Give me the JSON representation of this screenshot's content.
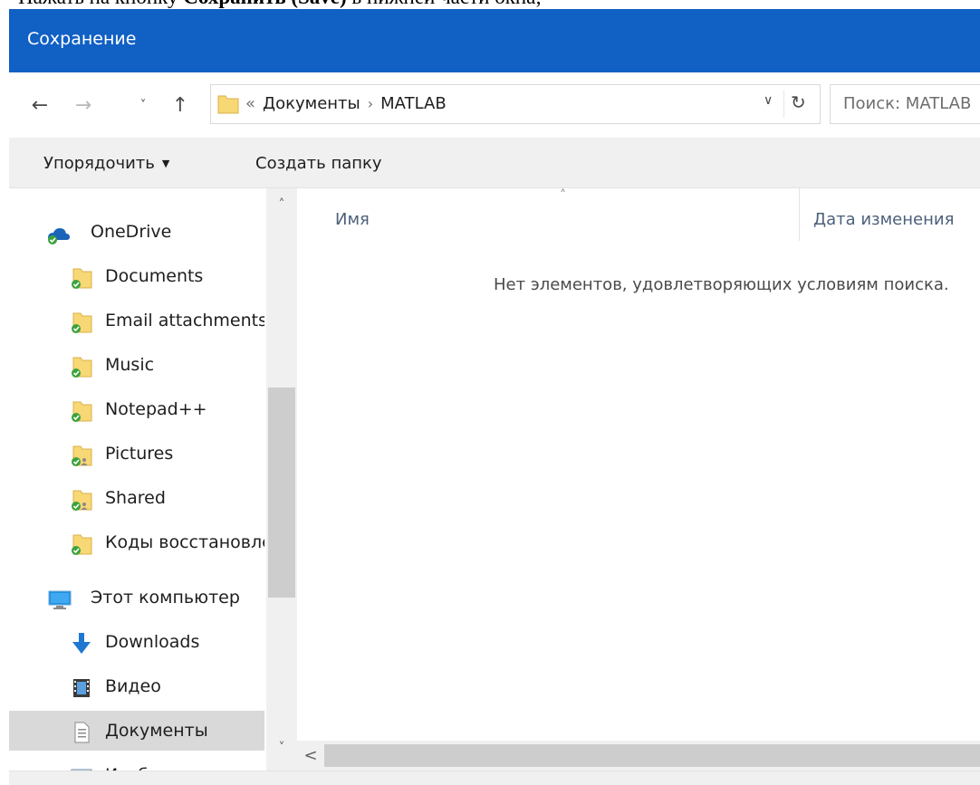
{
  "doc_caption": {
    "prefix": "Нажать на кнопку ",
    "bold": "Сохранить (Save)",
    "suffix": " в нижней части окна;"
  },
  "window": {
    "title": "Сохранение"
  },
  "nav": {
    "back_icon": "←",
    "forward_icon": "→",
    "recent_icon": "˅",
    "up_icon": "↑",
    "breadcrumb_overflow": "«",
    "breadcrumb": [
      "Документы",
      "MATLAB"
    ],
    "breadcrumb_sep": "›",
    "dropdown_icon": "∨",
    "refresh_icon": "↻",
    "search_placeholder": "Поиск: MATLAB"
  },
  "toolbar": {
    "organize_label": "Упорядочить",
    "organize_caret": "▼",
    "new_folder_label": "Создать папку"
  },
  "sidebar": {
    "items": [
      {
        "label": "OneDrive",
        "icon": "onedrive-cloud-icon"
      },
      {
        "label": "Documents",
        "icon": "synced-folder-icon"
      },
      {
        "label": "Email attachments",
        "icon": "synced-folder-icon"
      },
      {
        "label": "Music",
        "icon": "synced-folder-icon"
      },
      {
        "label": "Notepad++",
        "icon": "synced-folder-icon"
      },
      {
        "label": "Pictures",
        "icon": "shared-synced-folder-icon"
      },
      {
        "label": "Shared",
        "icon": "shared-synced-folder-icon"
      },
      {
        "label": "Коды восстановления",
        "icon": "synced-folder-icon"
      },
      {
        "label": "Этот компьютер",
        "icon": "computer-icon"
      },
      {
        "label": "Downloads",
        "icon": "download-icon"
      },
      {
        "label": "Видео",
        "icon": "video-icon"
      },
      {
        "label": "Документы",
        "icon": "documents-icon",
        "selected": true
      },
      {
        "label": "Изображения",
        "icon": "pictures-icon"
      }
    ]
  },
  "scroll": {
    "up": "˄",
    "down": "˅",
    "left": "<",
    "sort_indicator": "˄"
  },
  "content": {
    "columns": [
      "Имя",
      "Дата изменения"
    ],
    "empty_message": "Нет элементов, удовлетворяющих условиям поиска."
  },
  "colors": {
    "titlebar": "#1160c4",
    "selected": "#d9d9d9",
    "folder": "#f8d775",
    "sync_green": "#3ca23c"
  }
}
